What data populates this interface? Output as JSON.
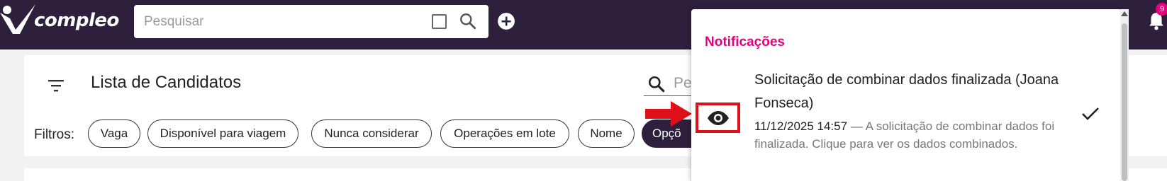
{
  "colors": {
    "topbar": "#2e1f3d",
    "accent_pink": "#e6007e",
    "highlight_red": "#e0101b"
  },
  "header": {
    "logo_text": "compleo",
    "search": {
      "placeholder": "Pesquisar",
      "value": ""
    },
    "icons": [
      "search-icon",
      "checkbox-icon",
      "add-circle-icon",
      "bell-icon"
    ],
    "notification_badge": "9"
  },
  "main": {
    "title": "Lista de Candidatos",
    "search_placeholder": "Pe",
    "filters_label": "Filtros:",
    "chips": [
      "Vaga",
      "Disponível para viagem",
      "Nunca considerar",
      "Operações em lote",
      "Nome",
      "Opçõ"
    ]
  },
  "notifications": {
    "title": "Notificações",
    "items": [
      {
        "heading": "Solicitação de combinar dados finalizada (Joana Fonseca)",
        "time": "11/12/2025 14:57",
        "body": " — A solicitação de combinar dados foi finalizada. Clique para ver os dados combinados.",
        "icons": [
          "eye-icon",
          "check-icon"
        ]
      }
    ]
  }
}
